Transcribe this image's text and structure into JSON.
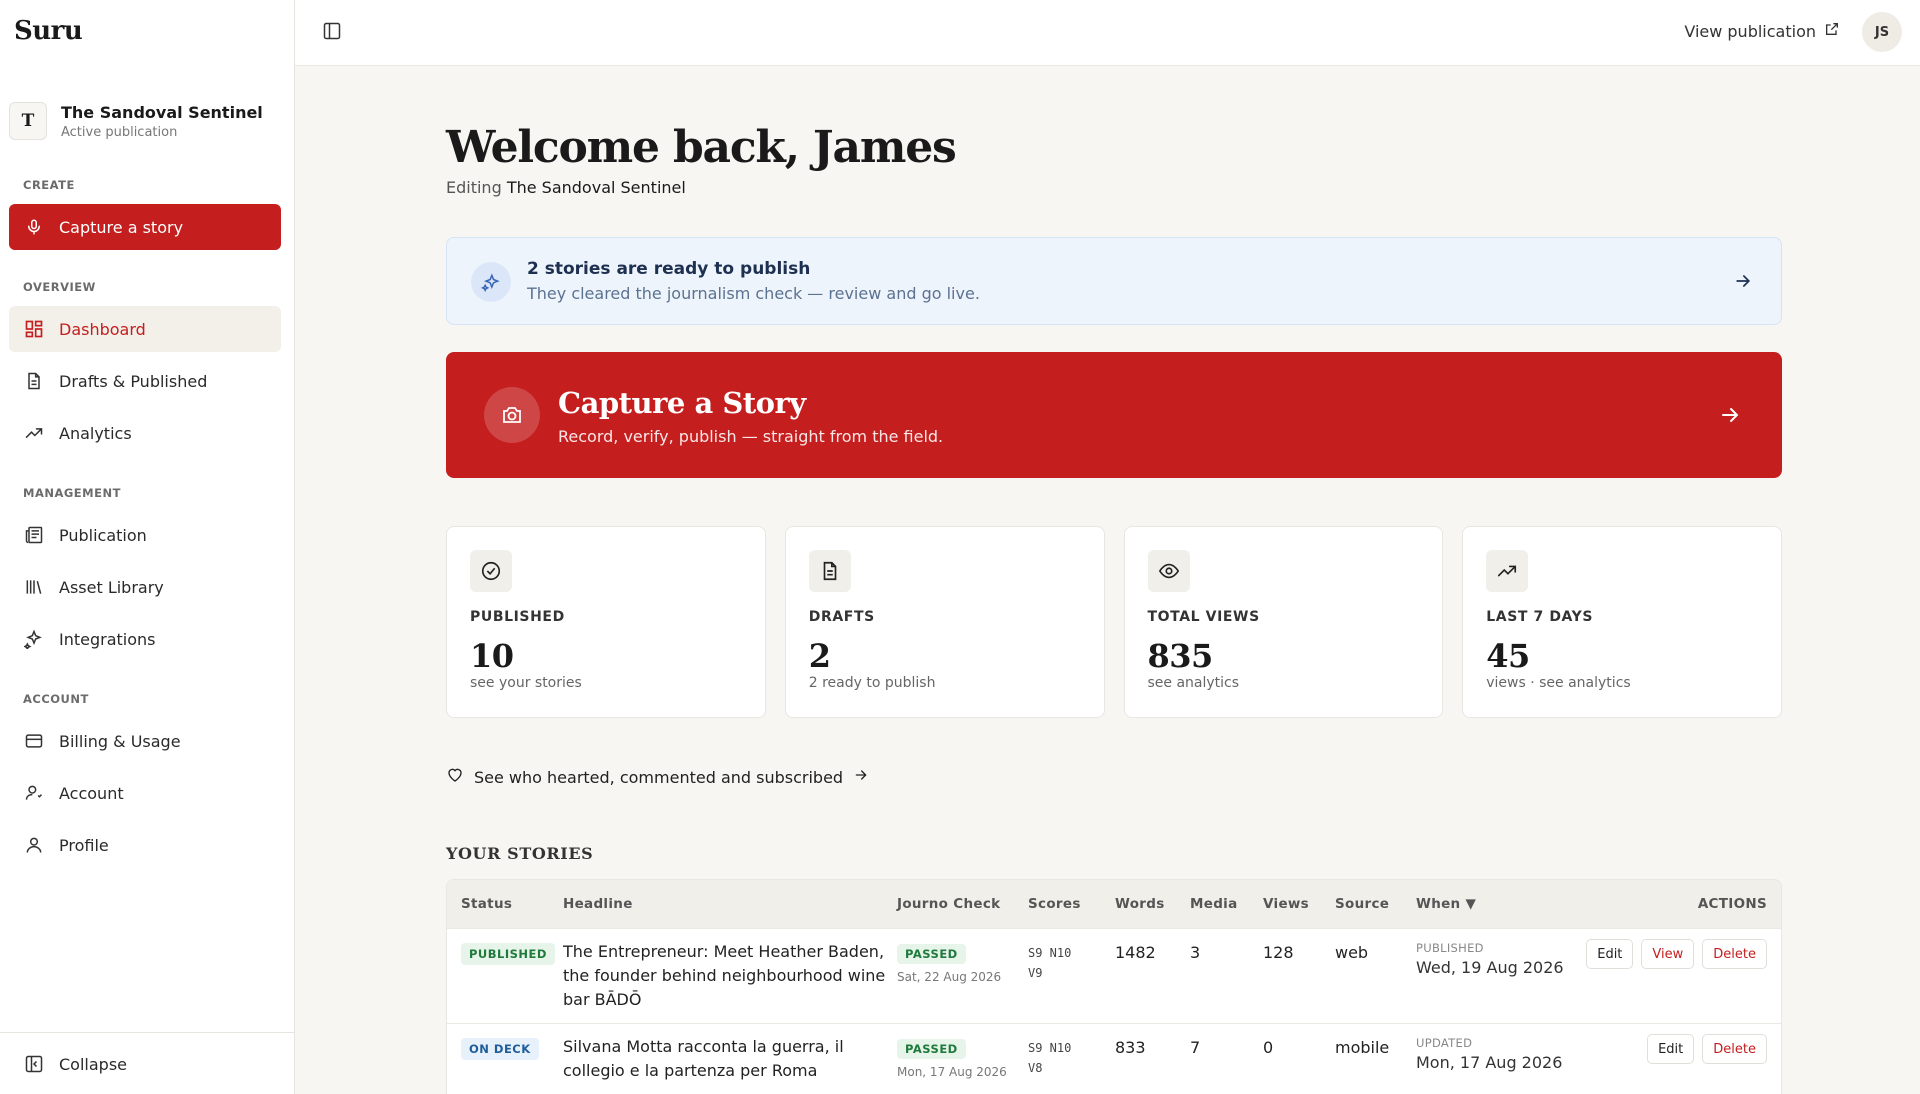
{
  "app": {
    "name": "Suru"
  },
  "publication": {
    "initial": "T",
    "name": "The Sandoval Sentinel",
    "status": "Active publication"
  },
  "sidebar": {
    "create_label": "CREATE",
    "capture_label": "Capture a story",
    "overview_label": "OVERVIEW",
    "overview_items": [
      {
        "label": "Dashboard",
        "icon": "dashboard-icon"
      },
      {
        "label": "Drafts & Published",
        "icon": "document-icon"
      },
      {
        "label": "Analytics",
        "icon": "trending-icon"
      }
    ],
    "management_label": "MANAGEMENT",
    "management_items": [
      {
        "label": "Publication",
        "icon": "newspaper-icon"
      },
      {
        "label": "Asset Library",
        "icon": "library-icon"
      },
      {
        "label": "Integrations",
        "icon": "sparkles-icon"
      }
    ],
    "account_label": "ACCOUNT",
    "account_items": [
      {
        "label": "Billing & Usage",
        "icon": "credit-card-icon"
      },
      {
        "label": "Account",
        "icon": "user-settings-icon"
      },
      {
        "label": "Profile",
        "icon": "user-icon"
      }
    ],
    "collapse_label": "Collapse"
  },
  "topbar": {
    "view_publication": "View publication",
    "user_initials": "JS"
  },
  "welcome": {
    "title": "Welcome back, James",
    "editing_prefix": "Editing",
    "editing_name": "The Sandoval Sentinel"
  },
  "ready_banner": {
    "title": "2 stories are ready to publish",
    "subtitle": "They cleared the journalism check — review and go live."
  },
  "hero": {
    "title": "Capture a Story",
    "subtitle": "Record, verify, publish — straight from the field."
  },
  "stats": [
    {
      "label": "PUBLISHED",
      "value": "10",
      "sub": "see your stories",
      "icon": "check-circle-icon"
    },
    {
      "label": "DRAFTS",
      "value": "2",
      "sub": "2 ready to publish",
      "icon": "document-icon"
    },
    {
      "label": "TOTAL VIEWS",
      "value": "835",
      "sub": "see analytics",
      "icon": "eye-icon"
    },
    {
      "label": "LAST 7 DAYS",
      "value": "45",
      "sub": "views · see analytics",
      "icon": "trending-icon"
    }
  ],
  "hearted_link": "See who hearted, commented and subscribed",
  "stories": {
    "heading": "YOUR STORIES",
    "columns": [
      "Status",
      "Headline",
      "Journo Check",
      "Scores",
      "Words",
      "Media",
      "Views",
      "Source",
      "When ▼",
      "ACTIONS"
    ],
    "rows": [
      {
        "status": "PUBLISHED",
        "headline": "The Entrepreneur: Meet Heather Baden, the founder behind neighbourhood wine bar BĀDŌ",
        "check": "PASSED",
        "check_date": "Sat, 22 Aug 2026",
        "scores_line1": "S9 N10",
        "scores_line2": "V9",
        "words": "1482",
        "media": "3",
        "views": "128",
        "source": "web",
        "when_label": "PUBLISHED",
        "when_date": "Wed, 19 Aug 2026",
        "actions": [
          "Edit",
          "View",
          "Delete"
        ]
      },
      {
        "status": "ON DECK",
        "headline": "Silvana Motta racconta la guerra, il collegio e la partenza per Roma",
        "check": "PASSED",
        "check_date": "Mon, 17 Aug 2026",
        "scores_line1": "S9 N10",
        "scores_line2": "V8",
        "words": "833",
        "media": "7",
        "views": "0",
        "source": "mobile",
        "when_label": "UPDATED",
        "when_date": "Mon, 17 Aug 2026",
        "actions": [
          "Edit",
          "Delete"
        ]
      }
    ]
  },
  "colors": {
    "accent": "#c41e1e",
    "banner_bg": "#eef4fc",
    "page_bg": "#f7f6f3"
  }
}
